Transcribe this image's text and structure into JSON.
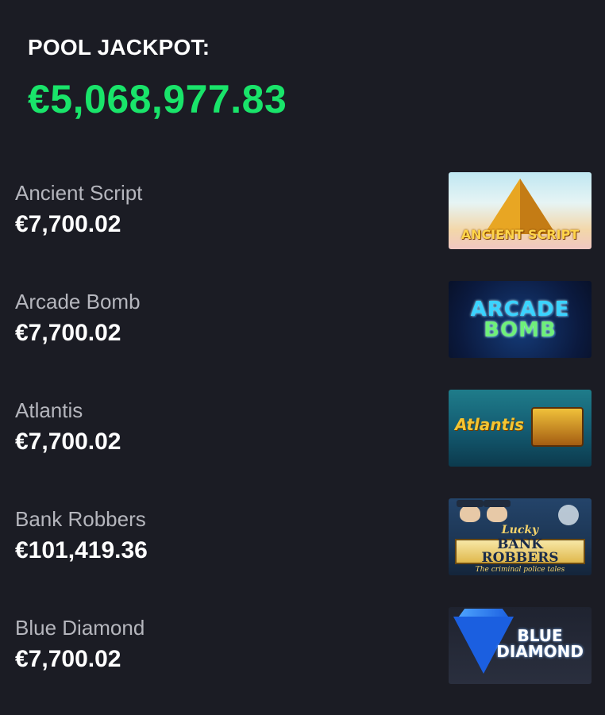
{
  "pool": {
    "label": "POOL JACKPOT:",
    "amount": "€5,068,977.83",
    "amount_color": "#19e46a"
  },
  "games": [
    {
      "name": "Ancient Script",
      "amount": "€7,700.02",
      "thumb_text": "ANCIENT SCRIPT",
      "icon": "ancient-script-thumbnail"
    },
    {
      "name": "Arcade Bomb",
      "amount": "€7,700.02",
      "thumb_line1": "ARCADE",
      "thumb_line2": "BOMB",
      "icon": "arcade-bomb-thumbnail"
    },
    {
      "name": "Atlantis",
      "amount": "€7,700.02",
      "thumb_text": "Atlantis",
      "icon": "atlantis-thumbnail"
    },
    {
      "name": "Bank Robbers",
      "amount": "€101,419.36",
      "thumb_lucky": "Lucky",
      "thumb_text": "BANK ROBBERS",
      "thumb_sub": "The criminal police tales",
      "icon": "bank-robbers-thumbnail"
    },
    {
      "name": "Blue Diamond",
      "amount": "€7,700.02",
      "thumb_line1": "BLUE",
      "thumb_line2": "DIAMOND",
      "icon": "blue-diamond-thumbnail"
    }
  ]
}
